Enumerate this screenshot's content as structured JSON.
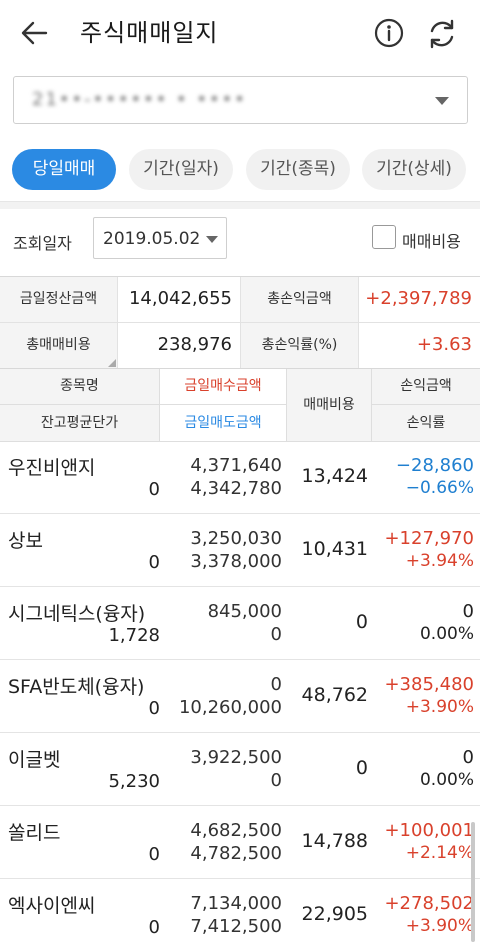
{
  "header": {
    "title": "주식매매일지",
    "icons": {
      "back": "arrow-left-icon",
      "info": "info-circle-icon",
      "refresh": "refresh-icon"
    }
  },
  "account": {
    "value": "21••-•••••• • ••••"
  },
  "tabs": [
    {
      "label": "당일매매",
      "active": true
    },
    {
      "label": "기간(일자)",
      "active": false
    },
    {
      "label": "기간(종목)",
      "active": false
    },
    {
      "label": "기간(상세)",
      "active": false
    }
  ],
  "query": {
    "label": "조회일자",
    "date": "2019.05.02",
    "fee_label": "매매비용"
  },
  "summary": {
    "settle_label": "금일정산금액",
    "settle_value": "14,042,655",
    "total_pl_label": "총손익금액",
    "total_pl_value": "+2,397,789",
    "fee_label": "총매매비용",
    "fee_value": "238,976",
    "rate_label": "총손익률(%)",
    "rate_value": "+3.63"
  },
  "table_header": {
    "name": "종목명",
    "avg": "잔고평균단가",
    "buy": "금일매수금액",
    "sell": "금일매도금액",
    "fee": "매매비용",
    "pl": "손익금액",
    "rate": "손익률"
  },
  "rows": [
    {
      "name": "우진비앤지",
      "avg": "0",
      "buy": "4,371,640",
      "sell": "4,342,780",
      "fee": "13,424",
      "pl": "−28,860",
      "rate": "−0.66%"
    },
    {
      "name": "상보",
      "avg": "0",
      "buy": "3,250,030",
      "sell": "3,378,000",
      "fee": "10,431",
      "pl": "+127,970",
      "rate": "+3.94%"
    },
    {
      "name": "시그네틱스(융자)",
      "avg": "1,728",
      "buy": "845,000",
      "sell": "0",
      "fee": "0",
      "pl": "0",
      "rate": "0.00%"
    },
    {
      "name": "SFA반도체(융자)",
      "avg": "0",
      "buy": "0",
      "sell": "10,260,000",
      "fee": "48,762",
      "pl": "+385,480",
      "rate": "+3.90%"
    },
    {
      "name": "이글벳",
      "avg": "5,230",
      "buy": "3,922,500",
      "sell": "0",
      "fee": "0",
      "pl": "0",
      "rate": "0.00%"
    },
    {
      "name": "쏠리드",
      "avg": "0",
      "buy": "4,682,500",
      "sell": "4,782,500",
      "fee": "14,788",
      "pl": "+100,001",
      "rate": "+2.14%"
    },
    {
      "name": "엑사이엔씨",
      "avg": "0",
      "buy": "7,134,000",
      "sell": "7,412,500",
      "fee": "22,905",
      "pl": "+278,502",
      "rate": "+3.90%"
    }
  ],
  "colors": {
    "accent": "#2b8ae3",
    "profit": "#d9412c",
    "loss": "#1f7fd0"
  }
}
